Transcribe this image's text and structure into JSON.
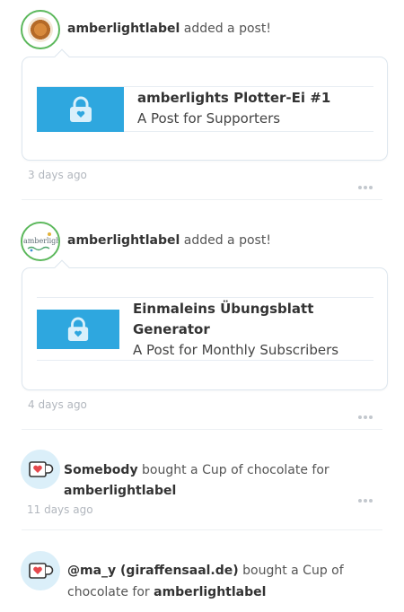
{
  "feed": [
    {
      "type": "post",
      "author": "amberlightlabel",
      "action": "added a post!",
      "post_title": "amberlights Plotter-Ei #1",
      "post_subtitle": "A Post for Supporters",
      "time": "3 days ago"
    },
    {
      "type": "post",
      "author": "amberlightlabel",
      "action": "added a post!",
      "post_title_line1": "Einmaleins Übungsblatt",
      "post_title_line2": "Generator",
      "post_subtitle": "A Post for Monthly Subscribers",
      "time": "4 days ago"
    },
    {
      "type": "purchase",
      "buyer": "Somebody",
      "action": "bought a Cup of chocolate for",
      "recipient": "amberlightlabel",
      "time": "11 days ago"
    },
    {
      "type": "purchase",
      "buyer": "@ma_y (giraffensaal.de)",
      "action_line1": "bought a Cup of",
      "action_line2": "chocolate for",
      "recipient": "amberlightlabel"
    }
  ],
  "icons": {
    "lock": "lock-icon",
    "cup": "coffee-cup-heart-icon",
    "more": "more-dots-icon"
  },
  "colors": {
    "accent_blue": "#2ea7df",
    "avatar_ring": "#5cb85c",
    "cup_bg": "#dbeff9",
    "cup_heart": "#e5484d"
  },
  "avatar_2_text": "amberlight-L"
}
